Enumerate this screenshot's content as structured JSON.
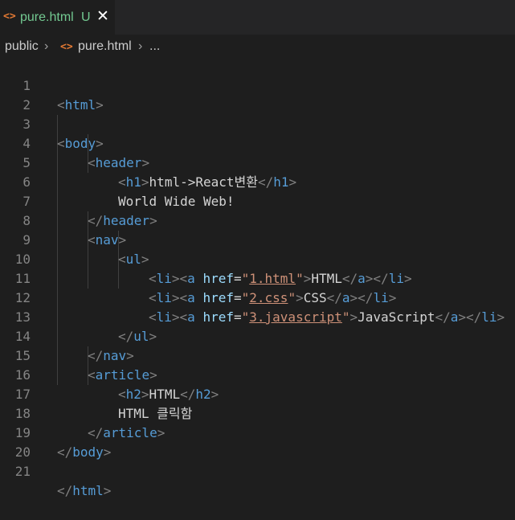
{
  "tab": {
    "icon": "<>",
    "filename": "pure.html",
    "status": "U",
    "close": "✕"
  },
  "breadcrumb": {
    "folder": "public",
    "sep": "›",
    "icon": "<>",
    "file": "pure.html",
    "more": "..."
  },
  "editor": {
    "line_numbers": [
      "1",
      "2",
      "3",
      "4",
      "5",
      "6",
      "7",
      "8",
      "9",
      "10",
      "11",
      "12",
      "13",
      "14",
      "15",
      "16",
      "17",
      "18",
      "19",
      "20",
      "21"
    ],
    "tags": {
      "html": "html",
      "body": "body",
      "header": "header",
      "h1": "h1",
      "nav": "nav",
      "ul": "ul",
      "li": "li",
      "a": "a",
      "article": "article",
      "h2": "h2"
    },
    "attr_href": "href",
    "h1_text": "html->React변환",
    "header_text": "World Wide Web!",
    "links": [
      {
        "href": "1.html",
        "text": "HTML"
      },
      {
        "href": "2.css",
        "text": "CSS"
      },
      {
        "href": "3.javascript",
        "text": "JavaScript"
      }
    ],
    "h2_text": "HTML",
    "article_text": "HTML 클릭함"
  },
  "colors": {
    "background": "#1e1e1e",
    "tag": "#569cd6",
    "punctuation": "#808080",
    "attribute": "#9cdcfe",
    "string": "#ce9178",
    "text": "#d4d4d4",
    "untracked": "#73c991"
  }
}
